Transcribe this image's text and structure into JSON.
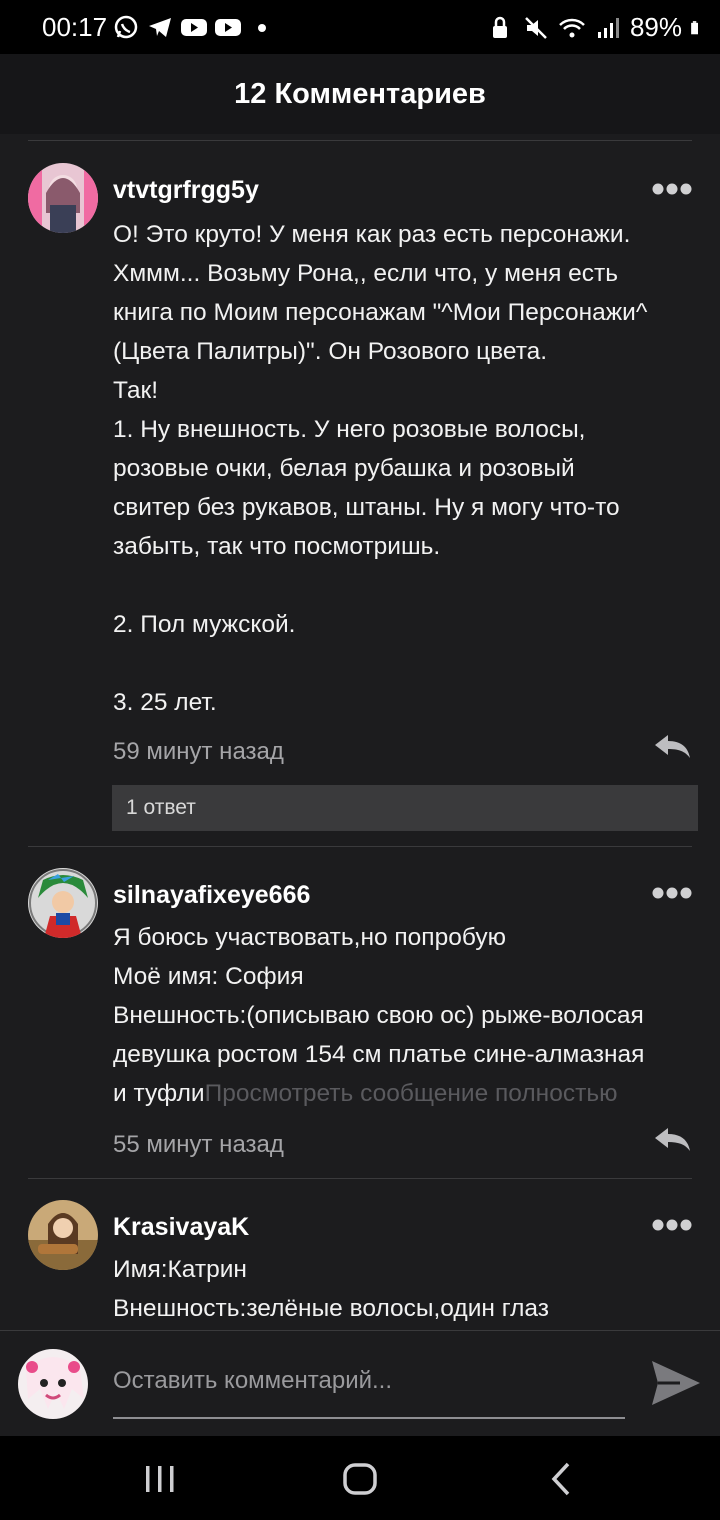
{
  "status_bar": {
    "time": "00:17",
    "battery": "89%",
    "left_icons": [
      "whatsapp-icon",
      "telegram-icon",
      "youtube-icon",
      "youtube-icon",
      "dot-icon"
    ],
    "right_icons": [
      "lock-icon",
      "mute-icon",
      "wifi-icon",
      "signal-icon",
      "battery-icon"
    ]
  },
  "header": {
    "title": "12 Комментариев"
  },
  "comments": [
    {
      "username": "vtvtgrfrgg5y",
      "text": "О! Это круто! У меня как раз есть персонажи.\nХммм... Возьму Рона,, если что, у меня есть\nкнига по Моим персонажам \"^Мои Персонажи^\n(Цвета Палитры)\". Он Розового цвета.\nТак!\n1. Ну внешность. У него розовые волосы,\nрозовые очки, белая рубашка и розовый\nсвитер без рукавов, штаны. Ну я могу что-то\nзабыть, так что посмотришь.\n\n2. Пол мужской.\n\n3. 25 лет.",
      "time": "59 минут назад",
      "replies": "1 ответ"
    },
    {
      "username": "silnayafixeye666",
      "text": "Я боюсь участвовать,но попробую\nМоё имя: София\nВнешность:(описываю свою ос) рыже-волосая\nдевушка ростом 154 см платье сине-алмазная\nи туфли",
      "more_link": "Просмотреть сообщение полностью",
      "time": "55 минут назад"
    },
    {
      "username": "KrasivayaK",
      "text": "Имя:Катрин\nВнешность:зелёные волосы,один глаз"
    }
  ],
  "input": {
    "placeholder": "Оставить комментарий..."
  },
  "colors": {
    "background": "#1c1c1e",
    "header": "#161618",
    "muted": "#a5a5a8",
    "reply_bar": "#3a3a3c"
  }
}
